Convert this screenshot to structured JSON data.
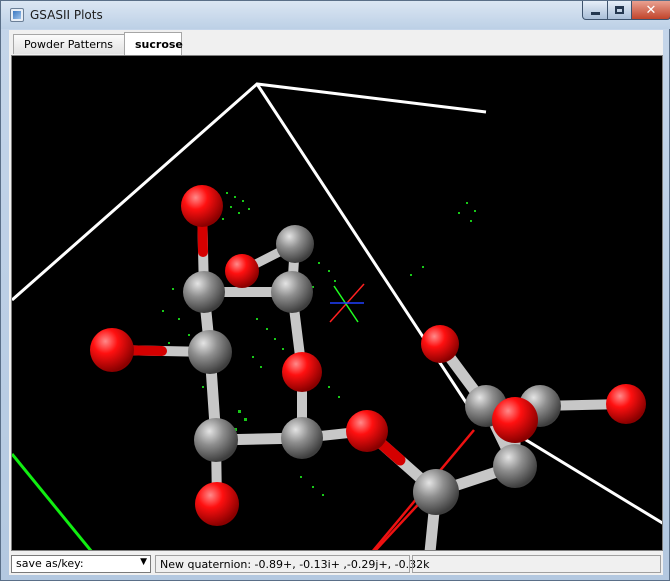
{
  "window": {
    "title": "GSASII Plots",
    "app_icon": "gsas-window-icon",
    "controls": [
      "minimize-icon",
      "maximize-icon",
      "close-icon"
    ]
  },
  "tabs": [
    {
      "label": "Powder Patterns",
      "selected": false
    },
    {
      "label": "sucrose",
      "selected": true
    }
  ],
  "status": {
    "save_select": "save as/key:",
    "message": "New quaternion: -0.89+, -0.13i+ ,-0.29j+, -0.32k"
  },
  "colors": {
    "background": "#000000",
    "cell_edge": "#ffffff",
    "oxygen": "#ff0000",
    "carbon": "#8c8c8c",
    "axis_a": "#ff0000",
    "axis_b": "#00ff00",
    "axis_c": "#0000ff",
    "density_map": "#00cc00"
  }
}
